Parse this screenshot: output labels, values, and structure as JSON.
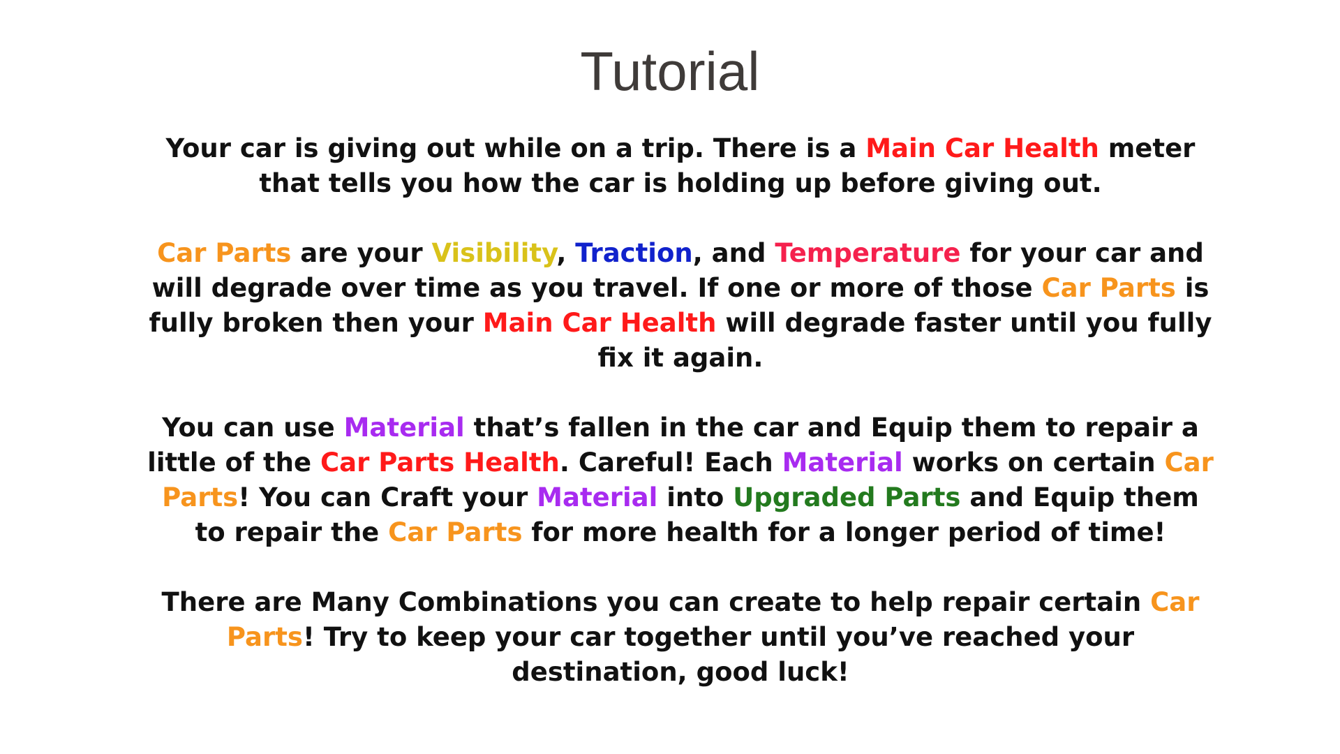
{
  "title": "Tutorial",
  "colors": {
    "text": "#111111",
    "title": "#3f3b39",
    "red": "#ff1a1a",
    "orange": "#f7941d",
    "yellow": "#d9c21a",
    "blue": "#1122cc",
    "crimson": "#f5214d",
    "purple": "#a82bf0",
    "green": "#237a1e"
  },
  "paragraphs": [
    [
      {
        "text": "Your car is giving out while on a trip. There is a ",
        "color": "text"
      },
      {
        "text": "Main Car Health",
        "color": "red"
      },
      {
        "text": " meter that tells you how the car is holding up before giving out.",
        "color": "text"
      }
    ],
    [
      {
        "text": "Car Parts",
        "color": "orange"
      },
      {
        "text": " are your ",
        "color": "text"
      },
      {
        "text": "Visibility",
        "color": "yellow"
      },
      {
        "text": ", ",
        "color": "text"
      },
      {
        "text": "Traction",
        "color": "blue"
      },
      {
        "text": ", and ",
        "color": "text"
      },
      {
        "text": "Temperature",
        "color": "crimson"
      },
      {
        "text": " for your car and will degrade over time as you travel. If one or more of those ",
        "color": "text"
      },
      {
        "text": "Car Parts",
        "color": "orange"
      },
      {
        "text": " is fully broken then your ",
        "color": "text"
      },
      {
        "text": "Main Car Health",
        "color": "red"
      },
      {
        "text": " will degrade faster until you fully fix it again.",
        "color": "text"
      }
    ],
    [
      {
        "text": "You can use ",
        "color": "text"
      },
      {
        "text": "Material",
        "color": "purple"
      },
      {
        "text": " that’s fallen in the car and Equip them to repair a little of the ",
        "color": "text"
      },
      {
        "text": "Car Parts Health",
        "color": "red"
      },
      {
        "text": ". Careful! Each ",
        "color": "text"
      },
      {
        "text": "Material",
        "color": "purple"
      },
      {
        "text": " works on certain ",
        "color": "text"
      },
      {
        "text": "Car Parts",
        "color": "orange"
      },
      {
        "text": "! You can Craft your ",
        "color": "text"
      },
      {
        "text": "Material",
        "color": "purple"
      },
      {
        "text": " into ",
        "color": "text"
      },
      {
        "text": "Upgraded Parts",
        "color": "green"
      },
      {
        "text": " and Equip them to repair the ",
        "color": "text"
      },
      {
        "text": "Car Parts",
        "color": "orange"
      },
      {
        "text": " for more health for a longer period of time!",
        "color": "text"
      }
    ],
    [
      {
        "text": "There are Many Combinations you can create to help repair certain ",
        "color": "text"
      },
      {
        "text": "Car Parts",
        "color": "orange"
      },
      {
        "text": "! Try to keep your car together until you’ve reached your destination, good luck!",
        "color": "text"
      }
    ]
  ]
}
